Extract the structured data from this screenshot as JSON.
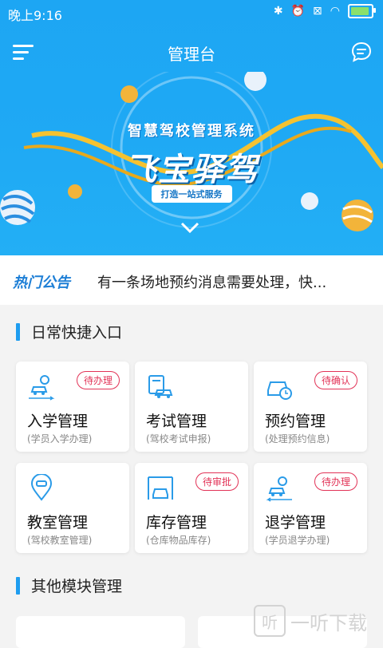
{
  "status_bar": {
    "time": "晚上9:16"
  },
  "header": {
    "title": "管理台"
  },
  "banner": {
    "subtitle": "智慧驾校管理系统",
    "main_title": "飞宝驿驾",
    "tagline": "打造一站式服务"
  },
  "notice": {
    "label": "热门公告",
    "text": "有一条场地预约消息需要处理，快..."
  },
  "section_daily": {
    "title": "日常快捷入口"
  },
  "cards": [
    {
      "title": "入学管理",
      "sub": "(学员入学办理)",
      "badge": "待办理"
    },
    {
      "title": "考试管理",
      "sub": "(驾校考试申报)",
      "badge": ""
    },
    {
      "title": "预约管理",
      "sub": "(处理预约信息)",
      "badge": "待确认"
    },
    {
      "title": "教室管理",
      "sub": "(驾校教室管理)",
      "badge": ""
    },
    {
      "title": "库存管理",
      "sub": "(仓库物品库存)",
      "badge": "待审批"
    },
    {
      "title": "退学管理",
      "sub": "(学员退学办理)",
      "badge": "待办理"
    }
  ],
  "section_other": {
    "title": "其他模块管理"
  },
  "watermark": {
    "icon": "听",
    "text": "一听下载"
  },
  "colors": {
    "accent": "#1e9df0",
    "badge": "#e23357",
    "icon_blue": "#2a9be8"
  }
}
